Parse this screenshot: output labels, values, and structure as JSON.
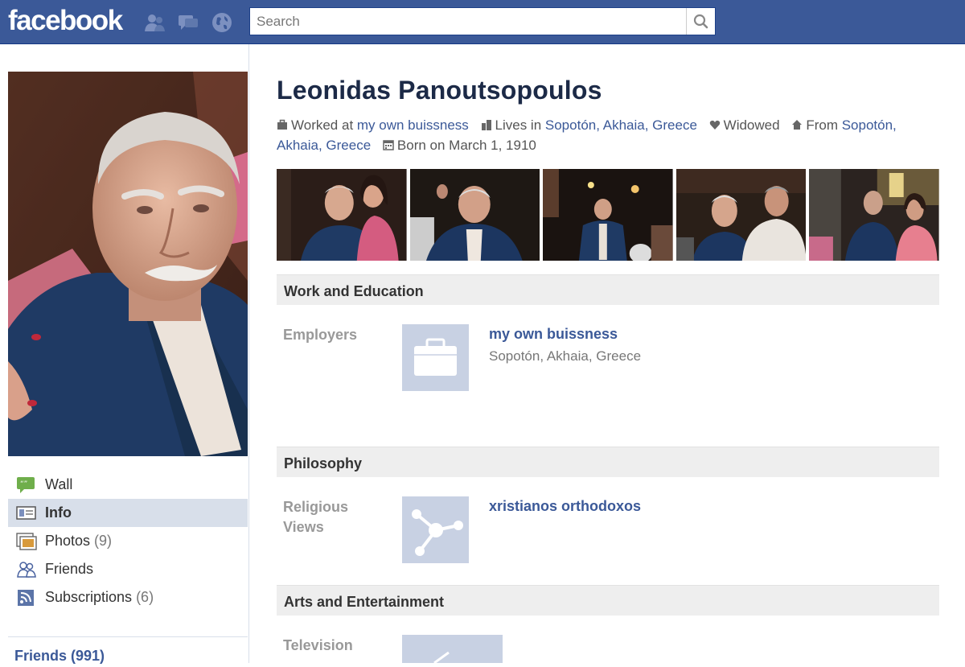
{
  "topbar": {
    "logo": "facebook",
    "search_placeholder": "Search"
  },
  "profile": {
    "name": "Leonidas Panoutsopoulos",
    "info": {
      "worked_prefix": "Worked at ",
      "worked_link": "my own buissness",
      "lives_prefix": "Lives in ",
      "lives_link": "Sopotón, Akhaia, Greece",
      "relationship": "Widowed",
      "from_prefix": "From ",
      "from_link_1": "Sopotón,",
      "from_link_2": "Akhaia, Greece",
      "born": "Born on March 1, 1910"
    }
  },
  "nav": {
    "items": [
      {
        "label": "Wall",
        "count": ""
      },
      {
        "label": "Info",
        "count": ""
      },
      {
        "label": "Photos",
        "count": "(9)"
      },
      {
        "label": "Friends",
        "count": ""
      },
      {
        "label": "Subscriptions",
        "count": "(6)"
      }
    ],
    "friends_link": "Friends (991)"
  },
  "sections": {
    "work": {
      "title": "Work and Education",
      "label": "Employers",
      "item_title": "my own buissness",
      "item_sub": "Sopotón, Akhaia, Greece"
    },
    "philosophy": {
      "title": "Philosophy",
      "label": "Religious Views",
      "item_title": "xristianos orthodoxos"
    },
    "arts": {
      "title": "Arts and Entertainment",
      "label": "Television"
    }
  },
  "colors": {
    "brand_blue": "#3b5998",
    "nav_active": "#d8dfea",
    "section_bg": "#eeeeee"
  }
}
